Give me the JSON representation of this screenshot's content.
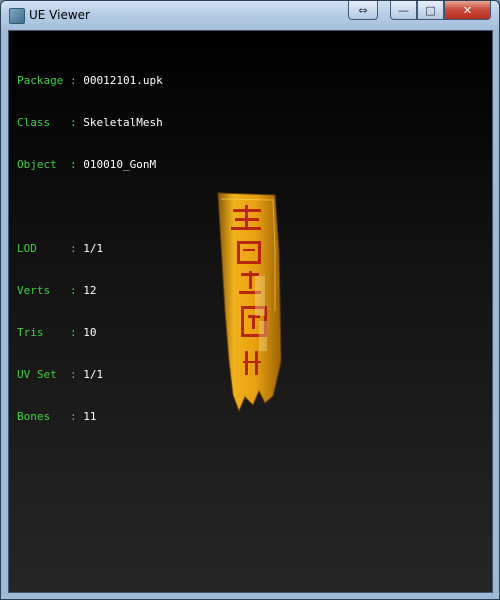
{
  "window": {
    "title": "UE Viewer",
    "controls": {
      "swap": "⇔",
      "minimize": "—",
      "maximize": "□",
      "close": "✕"
    }
  },
  "info": {
    "package_label": "Package",
    "package_value": "00012101.upk",
    "class_label": "Class  ",
    "class_value": "SkeletalMesh",
    "object_label": "Object ",
    "object_value": "010010_GonM",
    "lod_label": "LOD    ",
    "lod_value": "1/1",
    "verts_label": "Verts  ",
    "verts_value": "12",
    "tris_label": "Tris   ",
    "tris_value": "10",
    "uvset_label": "UV Set ",
    "uvset_value": "1/1",
    "bones_label": "Bones  ",
    "bones_value": "11",
    "separator": " : "
  },
  "colors": {
    "label": "#3fd23f",
    "value": "#ffffff",
    "banner_gold": "#e6a414",
    "banner_text": "#b01010"
  },
  "icons": [
    "app-icon",
    "swap-icon",
    "minimize-icon",
    "maximize-icon",
    "close-icon"
  ]
}
